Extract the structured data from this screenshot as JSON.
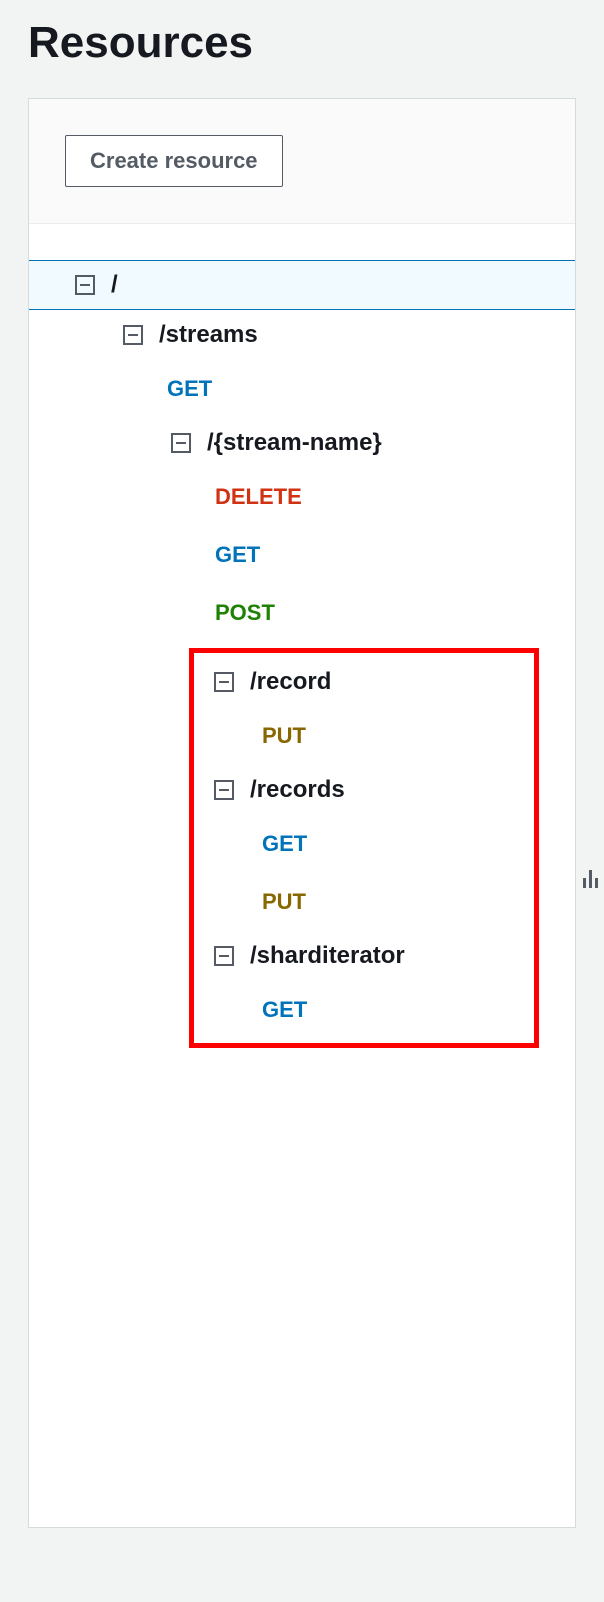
{
  "title": "Resources",
  "buttons": {
    "create_resource": "Create resource"
  },
  "tree": {
    "root": "/",
    "streams": {
      "label": "/streams",
      "methods": {
        "get": "GET"
      },
      "stream_name": {
        "label": "/{stream-name}",
        "methods": {
          "delete": "DELETE",
          "get": "GET",
          "post": "POST"
        },
        "record": {
          "label": "/record",
          "methods": {
            "put": "PUT"
          }
        },
        "records": {
          "label": "/records",
          "methods": {
            "get": "GET",
            "put": "PUT"
          }
        },
        "sharditerator": {
          "label": "/sharditerator",
          "methods": {
            "get": "GET"
          }
        }
      }
    }
  }
}
